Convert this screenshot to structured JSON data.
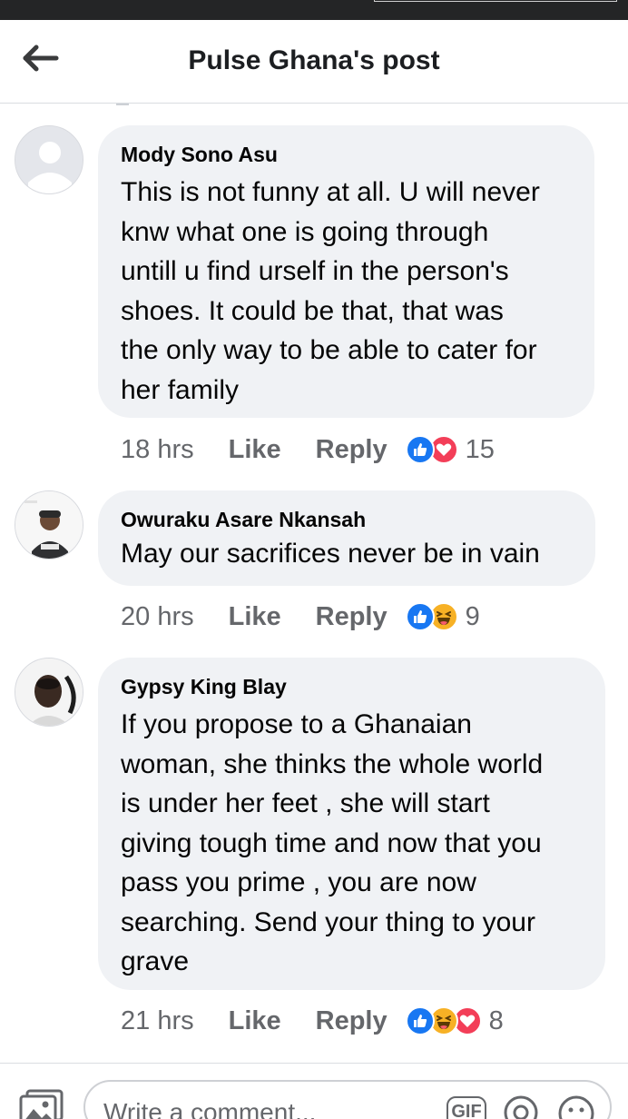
{
  "header": {
    "title": "Pulse Ghana's post"
  },
  "comments": [
    {
      "author": "Mody Sono Asu",
      "text": "This is not funny at all. U will never\nknw what one is going through\nuntill u find urself in the person's\nshoes. It could be that,  that was\nthe only way to be able to cater for\nher family",
      "time": "18 hrs",
      "like_label": "Like",
      "reply_label": "Reply",
      "reactions": [
        "like-reaction-icon",
        "love-reaction-icon"
      ],
      "reaction_count": "15",
      "avatar": "default-avatar-icon"
    },
    {
      "author": "Owuraku Asare Nkansah",
      "text": "May our sacrifices never be in vain",
      "time": "20 hrs",
      "like_label": "Like",
      "reply_label": "Reply",
      "reactions": [
        "like-reaction-icon",
        "haha-reaction-icon"
      ],
      "reaction_count": "9",
      "avatar": "profile-photo"
    },
    {
      "author": "Gypsy King Blay",
      "text": "If you propose to a Ghanaian\nwoman, she thinks the whole world\nis under her feet , she will start\ngiving tough time and now that you\npass you prime , you are now\nsearching. Send your thing to your\ngrave",
      "time": "21 hrs",
      "like_label": "Like",
      "reply_label": "Reply",
      "reactions": [
        "like-reaction-icon",
        "haha-reaction-icon",
        "love-reaction-icon"
      ],
      "reaction_count": "8",
      "avatar": "profile-photo"
    }
  ],
  "composer": {
    "placeholder": "Write a comment...",
    "gif_label": "GIF"
  },
  "colors": {
    "like_blue": "#1877f2",
    "love_red": "#f33e58",
    "haha_yellow": "#f7b125",
    "meta_gray": "#65676b",
    "bubble_bg": "#f0f2f5"
  }
}
